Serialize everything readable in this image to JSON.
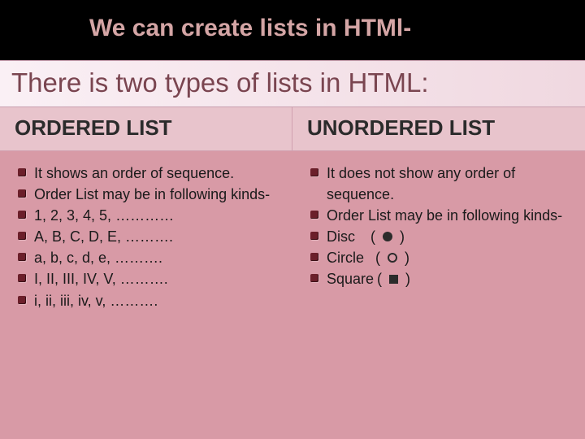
{
  "title": "We can create lists in HTMl-",
  "subtitle": "There is two types of lists in HTML:",
  "left": {
    "header": "ORDERED LIST",
    "items": [
      "It shows an order of sequence.",
      "Order List may be in following kinds-",
      "1, 2, 3, 4, 5, …………",
      "A, B, C, D, E, ……….",
      "a, b, c, d, e, ……….",
      "I, II, III, IV, V, ……….",
      "i, ii, iii, iv, v, ………."
    ]
  },
  "right": {
    "header": "UNORDERED LIST",
    "items": [
      "It does not show any order of sequence.",
      "Order List may be in following kinds-",
      "Disc     ( ● )",
      "Circle   ( ○ )",
      "Square( ■ )"
    ],
    "shape_labels": {
      "disc": "Disc",
      "circle": "Circle",
      "square": "Square"
    }
  }
}
